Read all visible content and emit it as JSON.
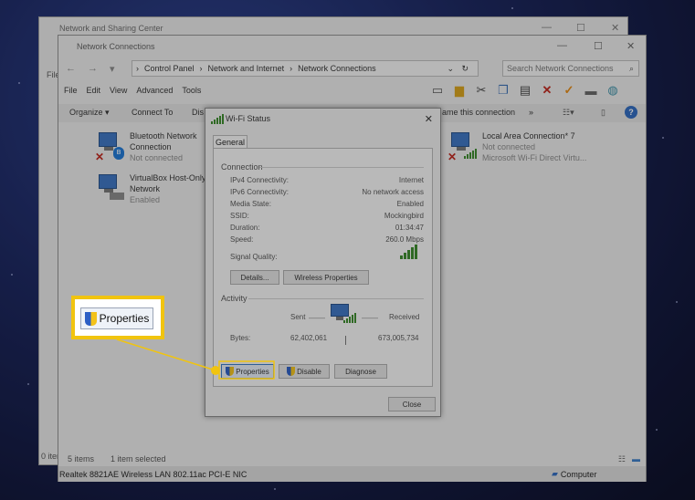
{
  "back_window": {
    "title": "Network and Sharing Center",
    "side_label": "File",
    "side_count": "0 items"
  },
  "window": {
    "title": "Network Connections",
    "breadcrumb": [
      "Control Panel",
      "Network and Internet",
      "Network Connections"
    ],
    "search_placeholder": "Search Network Connections",
    "menu": [
      "File",
      "Edit",
      "View",
      "Advanced",
      "Tools"
    ],
    "commands": {
      "organize": "Organize ▾",
      "connect_to": "Connect To",
      "clipped": "Dis",
      "rename": "ame this connection",
      "more": "»"
    },
    "items": [
      {
        "name": "Bluetooth Network Connection",
        "line1": "Bluetooth Network",
        "line2": "Connection",
        "status": "Not connected"
      },
      {
        "name": "VirtualBox Host-Only Network",
        "line1": "VirtualBox Host-Only",
        "line2": "Network",
        "status": "Enabled"
      },
      {
        "name": "Local Area Connection* 7",
        "line1": "Local Area Connection* 7",
        "status": "Not connected",
        "device": "Microsoft Wi-Fi Direct Virtu..."
      }
    ],
    "status_bar": {
      "count": "5 items",
      "selected": "1 item selected"
    },
    "bottom_bar": {
      "device": "Realtek 8821AE Wireless LAN 802.11ac PCI-E NIC",
      "computer": "Computer"
    }
  },
  "dialog": {
    "title": "Wi-Fi Status",
    "tab": "General",
    "connection_label": "Connection",
    "fields": [
      {
        "label": "IPv4 Connectivity:",
        "value": "Internet"
      },
      {
        "label": "IPv6 Connectivity:",
        "value": "No network access"
      },
      {
        "label": "Media State:",
        "value": "Enabled"
      },
      {
        "label": "SSID:",
        "value": "Mockingbird"
      },
      {
        "label": "Duration:",
        "value": "01:34:47"
      },
      {
        "label": "Speed:",
        "value": "260.0 Mbps"
      }
    ],
    "signal_label": "Signal Quality:",
    "signal_bars": 5,
    "details_button": "Details...",
    "wireless_button": "Wireless Properties",
    "activity_label": "Activity",
    "sent_label": "Sent",
    "received_label": "Received",
    "bytes_label": "Bytes:",
    "bytes_sent": "62,402,061",
    "bytes_received": "673,005,734",
    "properties_button": "Properties",
    "disable_button": "Disable",
    "diagnose_button": "Diagnose",
    "close_button": "Close"
  },
  "callout": {
    "label": "Properties",
    "color": "#f1c40f"
  }
}
